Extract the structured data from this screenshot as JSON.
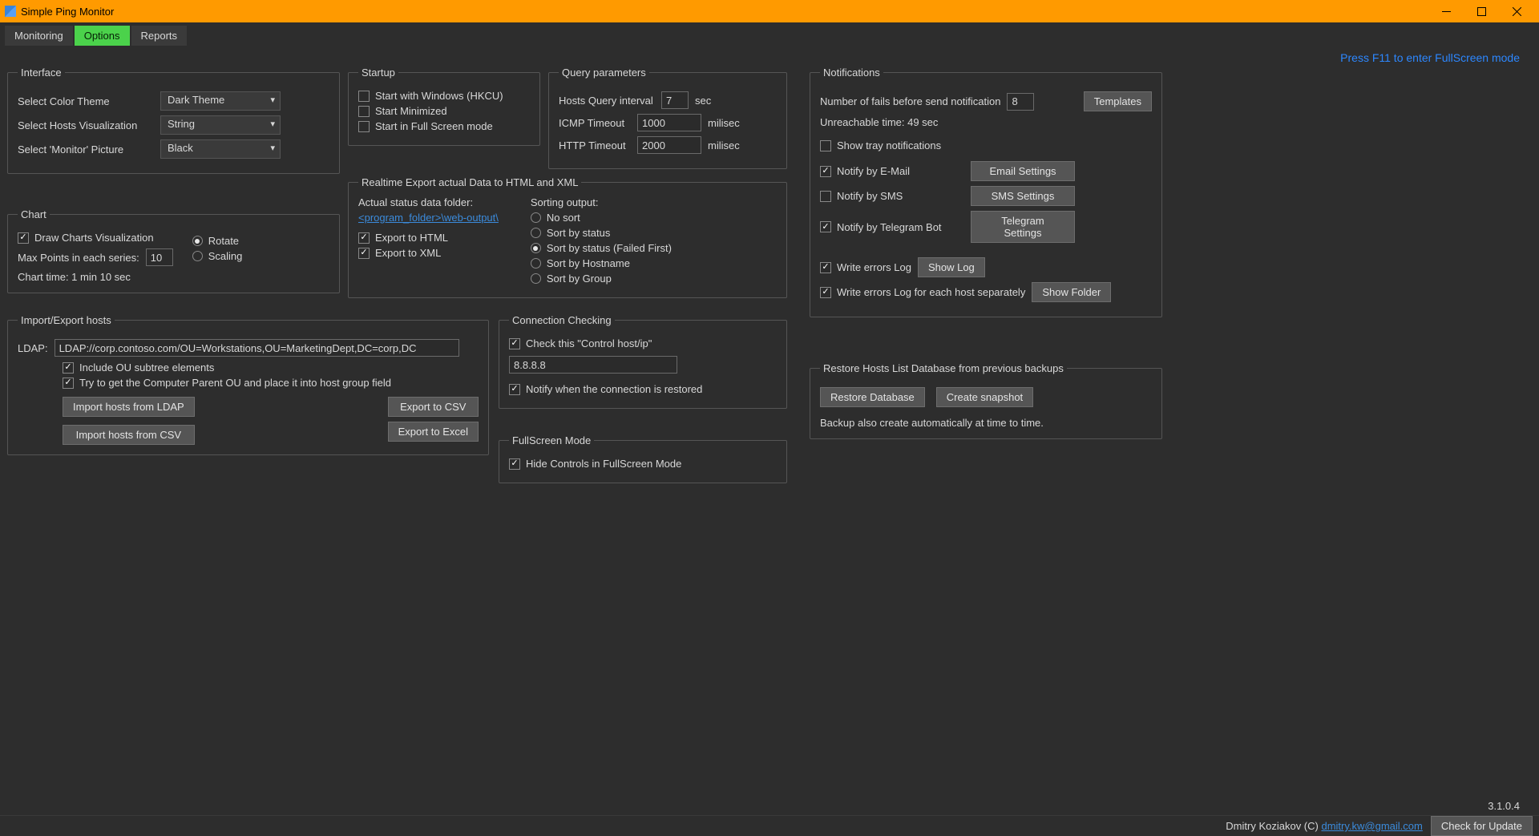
{
  "window": {
    "title": "Simple Ping Monitor"
  },
  "tabs": {
    "monitoring": "Monitoring",
    "options": "Options",
    "reports": "Reports"
  },
  "fs_hint": "Press F11 to enter FullScreen mode",
  "interface": {
    "legend": "Interface",
    "color_theme_label": "Select Color Theme",
    "color_theme_value": "Dark Theme",
    "hosts_vis_label": "Select Hosts Visualization",
    "hosts_vis_value": "String",
    "monitor_pic_label": "Select 'Monitor' Picture",
    "monitor_pic_value": "Black"
  },
  "chart": {
    "legend": "Chart",
    "draw_label": "Draw Charts Visualization",
    "max_points_label": "Max Points in each series:",
    "max_points_value": "10",
    "rotate_label": "Rotate",
    "scaling_label": "Scaling",
    "chart_time": "Chart time: 1 min 10 sec"
  },
  "import_export": {
    "legend": "Import/Export hosts",
    "ldap_label": "LDAP:",
    "ldap_value": "LDAP://corp.contoso.com/OU=Workstations,OU=MarketingDept,DC=corp,DC",
    "include_ou": "Include OU subtree elements",
    "try_ou": "Try to get the Computer Parent OU and place it into host group field",
    "import_ldap": "Import hosts from LDAP",
    "import_csv": "Import hosts from CSV",
    "export_csv": "Export to CSV",
    "export_excel": "Export to Excel"
  },
  "startup": {
    "legend": "Startup",
    "start_windows": "Start with Windows (HKCU)",
    "start_min": "Start Minimized",
    "start_fs": "Start in Full Screen mode"
  },
  "realtime": {
    "legend": "Realtime Export actual Data to HTML and XML",
    "status_folder_label": "Actual status data folder:",
    "status_folder_link": "<program_folder>\\web-output\\",
    "export_html": "Export to HTML",
    "export_xml": "Export to XML",
    "sort_label": "Sorting output:",
    "sort_none": "No sort",
    "sort_status": "Sort by status",
    "sort_status_failed": "Sort by status (Failed First)",
    "sort_hostname": "Sort by Hostname",
    "sort_group": "Sort by Group"
  },
  "query": {
    "legend": "Query parameters",
    "interval_label": "Hosts Query interval",
    "interval_value": "7",
    "interval_unit": "sec",
    "icmp_label": "ICMP Timeout",
    "icmp_value": "1000",
    "icmp_unit": "milisec",
    "http_label": "HTTP Timeout",
    "http_value": "2000",
    "http_unit": "milisec"
  },
  "connection": {
    "legend": "Connection Checking",
    "check_host": "Check this \"Control host/ip\"",
    "host_value": "8.8.8.8",
    "notify_restored": "Notify when the connection is restored"
  },
  "fullscreen": {
    "legend": "FullScreen Mode",
    "hide_controls": "Hide Controls in FullScreen Mode"
  },
  "notifications": {
    "legend": "Notifications",
    "fails_label": "Number of fails before send notification",
    "fails_value": "8",
    "templates": "Templates",
    "unreachable": "Unreachable time: 49 sec",
    "tray": "Show tray notifications",
    "email": "Notify by E-Mail",
    "email_btn": "Email Settings",
    "sms": "Notify by SMS",
    "sms_btn": "SMS Settings",
    "telegram": "Notify by Telegram Bot",
    "telegram_btn": "Telegram Settings",
    "errors_log": "Write errors Log",
    "show_log": "Show Log",
    "errors_each": "Write errors Log for each host separately",
    "show_folder": "Show Folder"
  },
  "restore": {
    "legend": "Restore Hosts List Database from previous backups",
    "restore_btn": "Restore Database",
    "snapshot_btn": "Create snapshot",
    "note": "Backup also create automatically at time to time."
  },
  "version": "3.1.0.4",
  "footer": {
    "author": "Dmitry Koziakov (C) ",
    "email": "dmitry.kw@gmail.com",
    "check_update": "Check for Update"
  }
}
